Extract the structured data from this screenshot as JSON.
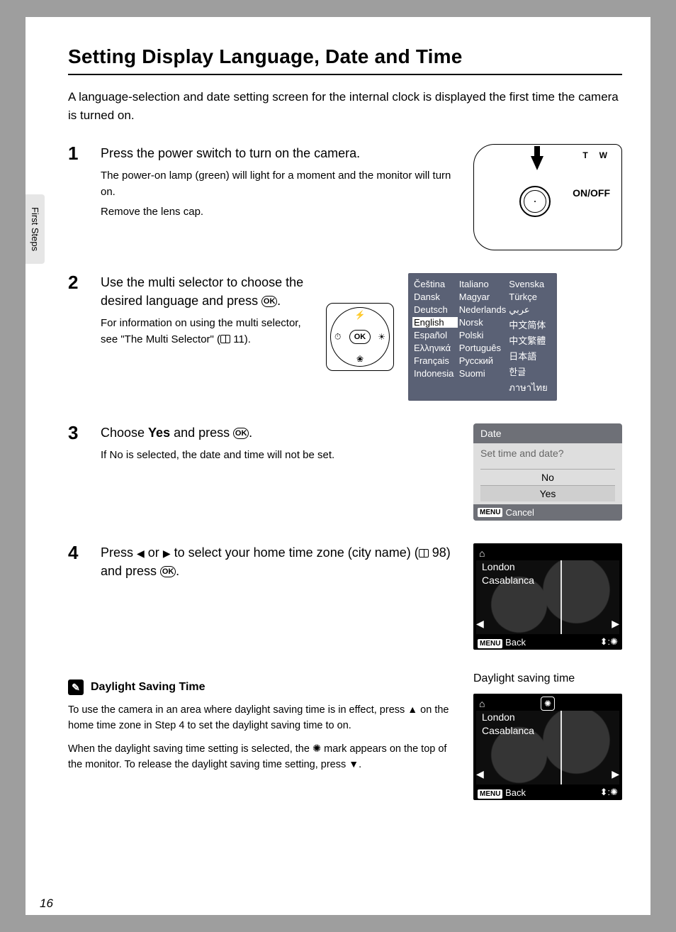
{
  "title": "Setting Display Language, Date and Time",
  "intro": "A language-selection and date setting screen for the internal clock is displayed the first time the camera is turned on.",
  "side_tab": "First Steps",
  "page_number": "16",
  "steps": {
    "s1": {
      "num": "1",
      "title": "Press the power switch to turn on the camera.",
      "d1": "The power-on lamp (green) will light for a moment and the monitor will turn on.",
      "d2": "Remove the lens cap.",
      "cam_onoff": "ON/OFF",
      "cam_t": "T",
      "cam_w": "W"
    },
    "s2": {
      "num": "2",
      "title_a": "Use the multi selector to choose the desired language and press ",
      "title_b": ".",
      "d1_a": "For information on using the multi selector, see \"The Multi Selector\" (",
      "d1_page": " 11).",
      "ok": "OK",
      "languages": {
        "col1": [
          "Čeština",
          "Dansk",
          "Deutsch",
          "English",
          "Español",
          "Ελληνικά",
          "Français",
          "Indonesia"
        ],
        "col2": [
          "Italiano",
          "Magyar",
          "Nederlands",
          "Norsk",
          "Polski",
          "Português",
          "Русский",
          "Suomi"
        ],
        "col3": [
          "Svenska",
          "Türkçe",
          "عربي",
          "中文简体",
          "中文繁體",
          "日本語",
          "한글",
          "ภาษาไทย"
        ],
        "selected": "English"
      }
    },
    "s3": {
      "num": "3",
      "title_a": "Choose ",
      "title_bold": "Yes",
      "title_b": " and press ",
      "title_c": ".",
      "d1_a": "If ",
      "d1_bold": "No",
      "d1_b": " is selected, the date and time will not be set.",
      "screen": {
        "head": "Date",
        "question": "Set time and date?",
        "opt_no": "No",
        "opt_yes": "Yes",
        "menu": "MENU",
        "cancel": "Cancel"
      }
    },
    "s4": {
      "num": "4",
      "title_a": "Press ",
      "title_b": " or ",
      "title_c": " to select your home time zone (city name) (",
      "title_page": " 98) and press ",
      "title_d": ".",
      "screen": {
        "home_icon": "⌂",
        "city1": "London",
        "city2": "Casablanca",
        "menu": "MENU",
        "back": "Back"
      }
    }
  },
  "tip": {
    "head": "Daylight Saving Time",
    "p1_a": "To use the camera in an area where daylight saving time is in effect, press ",
    "p1_b": " on the home time zone in Step 4 to set the daylight saving time to on.",
    "p2_a": "When the daylight saving time setting is selected, the ",
    "p2_b": " mark appears on the top of the monitor. To release the daylight saving time setting, press ",
    "p2_c": ".",
    "label": "Daylight saving time",
    "screen": {
      "home_icon": "⌂",
      "city1": "London",
      "city2": "Casablanca",
      "menu": "MENU",
      "back": "Back"
    }
  }
}
